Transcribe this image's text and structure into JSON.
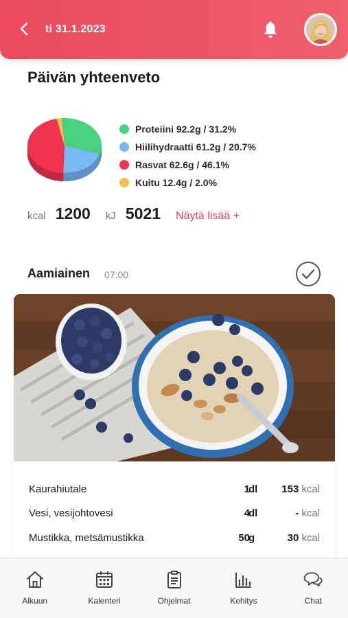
{
  "header": {
    "date": "ti 31.1.2023"
  },
  "summary": {
    "title": "Päivän yhteenveto",
    "legend": [
      {
        "label": "Proteiini 92.2g / 31.2%",
        "color": "#49d17e"
      },
      {
        "label": "Hiilihydraatti 61.2g / 20.7%",
        "color": "#78b8f5"
      },
      {
        "label": "Rasvat 62.6g / 46.1%",
        "color": "#f0334f"
      },
      {
        "label": "Kuitu 12.4g / 2.0%",
        "color": "#f5c04d"
      }
    ],
    "kcal_unit": "kcal",
    "kcal_value": "1200",
    "kj_unit": "kJ",
    "kj_value": "5021",
    "more_link": "Näytä lisää +"
  },
  "chart_data": {
    "type": "pie",
    "categories": [
      "Proteiini",
      "Hiilihydraatti",
      "Rasvat",
      "Kuitu"
    ],
    "values": [
      31.2,
      20.7,
      46.1,
      2.0
    ],
    "colors": [
      "#49d17e",
      "#78b8f5",
      "#f0334f",
      "#f5c04d"
    ]
  },
  "meal": {
    "title": "Aamiainen",
    "time": "07:00",
    "items": [
      {
        "name": "Kaurahiutale",
        "amount": "1",
        "unit": "dl",
        "kcal": "153",
        "kcal_unit": "kcal"
      },
      {
        "name": "Vesi, vesijohtovesi",
        "amount": "4",
        "unit": "dl",
        "kcal": "-",
        "kcal_unit": "kcal"
      },
      {
        "name": "Mustikka, metsämustikka",
        "amount": "50",
        "unit": "g",
        "kcal": "30",
        "kcal_unit": "kcal"
      }
    ]
  },
  "nav": [
    {
      "label": "Alkuun",
      "icon": "home-icon"
    },
    {
      "label": "Kalenteri",
      "icon": "calendar-icon"
    },
    {
      "label": "Ohjelmat",
      "icon": "clipboard-icon"
    },
    {
      "label": "Kehitys",
      "icon": "bar-chart-icon"
    },
    {
      "label": "Chat",
      "icon": "chat-icon"
    }
  ]
}
